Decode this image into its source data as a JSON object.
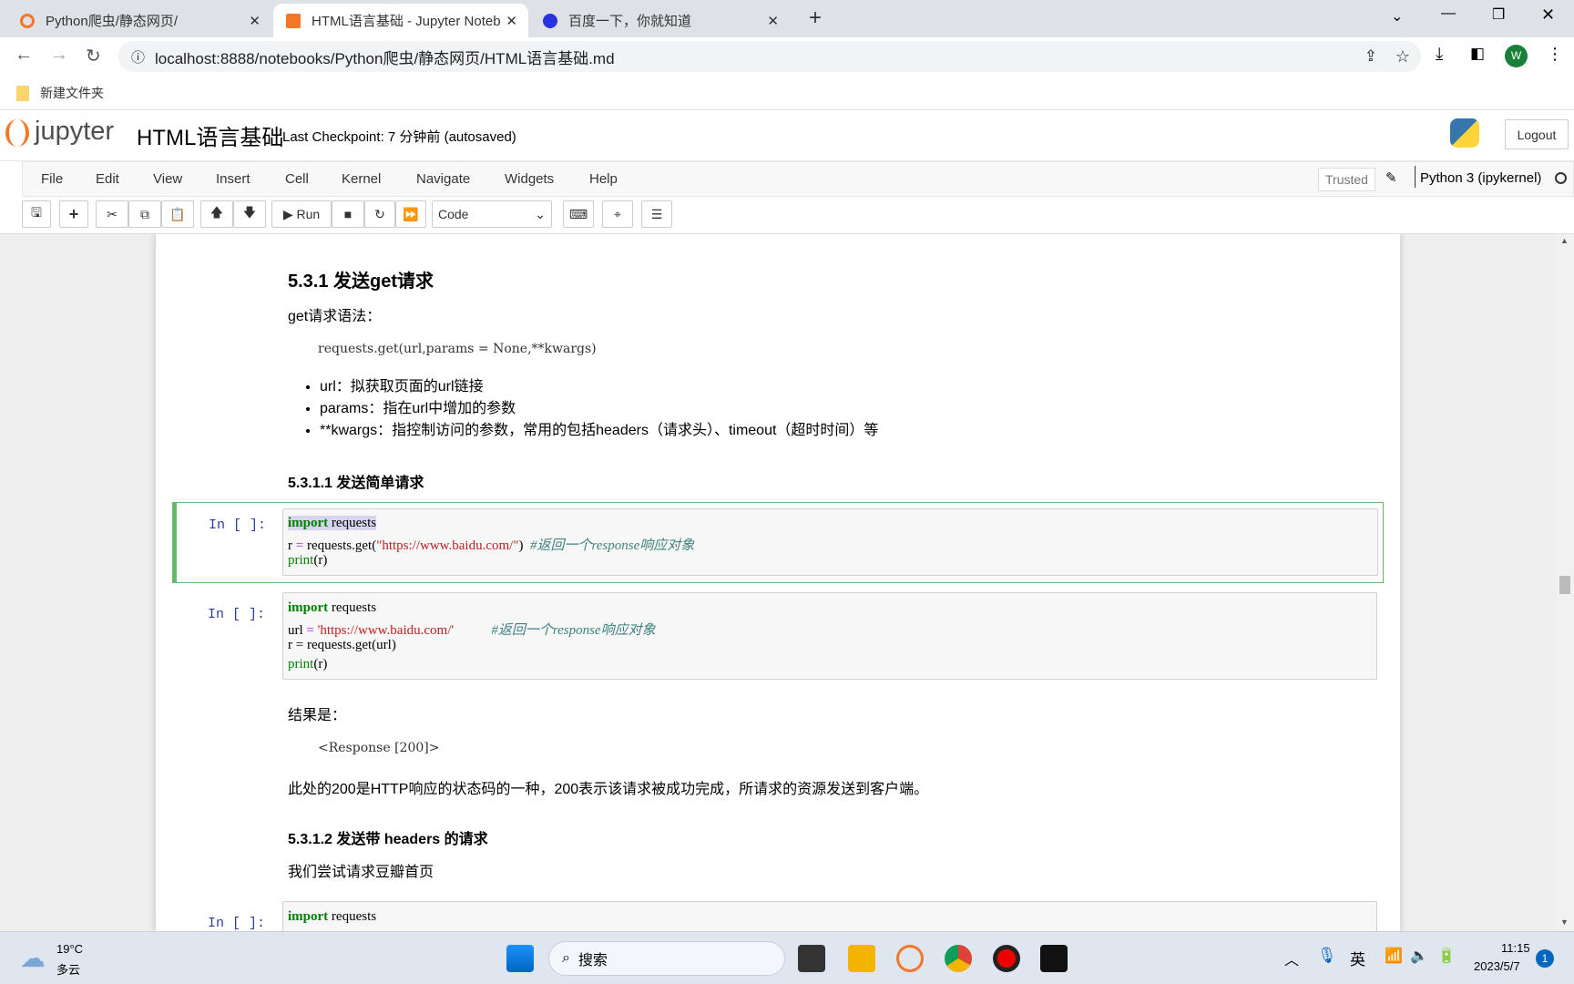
{
  "browser": {
    "tabs": [
      {
        "label": "Python爬虫/静态网页/",
        "active": false
      },
      {
        "label": "HTML语言基础 - Jupyter Noteb",
        "active": true
      },
      {
        "label": "百度一下，你就知道",
        "active": false
      }
    ],
    "url": "localhost:8888/notebooks/Python爬虫/静态网页/HTML语言基础.md",
    "bookmark": "新建文件夹",
    "profile_initial": "W"
  },
  "jupyter": {
    "logo": "jupyter",
    "title": "HTML语言基础",
    "checkpoint": "Last Checkpoint: 7 分钟前  (autosaved)",
    "logout": "Logout",
    "menu": [
      "File",
      "Edit",
      "View",
      "Insert",
      "Cell",
      "Kernel",
      "Navigate",
      "Widgets",
      "Help"
    ],
    "trusted": "Trusted",
    "kernel": "Python 3 (ipykernel)",
    "run_label": "Run",
    "cell_type": "Code"
  },
  "content": {
    "h531": "5.3.1  发送get请求",
    "syntax_label": "get请求语法：",
    "syntax_code": "requests.get(url,params = None,**kwargs)",
    "bullets": [
      "url：拟获取页面的url链接",
      "params：指在url中增加的参数",
      "**kwargs：指控制访问的参数，常用的包括headers（请求头）、timeout（超时时间）等"
    ],
    "h5311": "5.3.1.1  发送简单请求",
    "prompt": "In  [  ]:",
    "result_label": "结果是：",
    "result_code": "<Response [200]>",
    "explain": "此处的200是HTTP响应的状态码的一种，200表示该请求被成功完成，所请求的资源发送到客户端。",
    "h5312": "5.3.1.2  发送带 headers 的请求",
    "douban": "我们尝试请求豆瓣首页"
  },
  "code": {
    "c1": {
      "l1a": "import",
      "l1b": " requests",
      "l2a": "r ",
      "l2b": "=",
      "l2c": " requests.get(",
      "l2d": "\"https://www.baidu.com/\"",
      "l2e": ")  ",
      "l2f": "#返回一个response响应对象",
      "l3a": "print",
      "l3b": "(r)"
    },
    "c2": {
      "l1a": "import",
      "l1b": " requests",
      "l2a": "url ",
      "l2b": "=",
      "l2c": " ",
      "l2d": "'https://www.baidu.com/'",
      "l2e": "           ",
      "l2f": "#返回一个response响应对象",
      "l3": "r = requests.get(url)",
      "l4a": "print",
      "l4b": "(r)"
    },
    "c3": {
      "l1a": "import",
      "l1b": " requests"
    }
  },
  "taskbar": {
    "temp": "19°C",
    "weather": "多云",
    "search": "搜索",
    "ime": "英",
    "time": "11:15",
    "date": "2023/5/7",
    "badge": "1"
  }
}
